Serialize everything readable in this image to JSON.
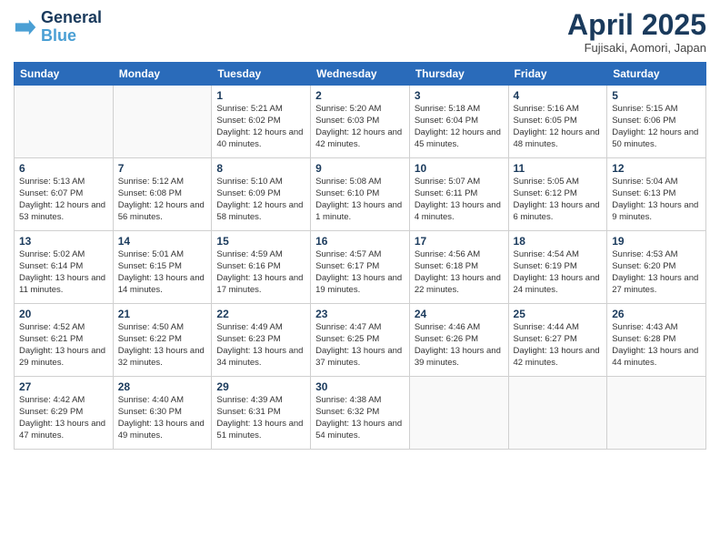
{
  "header": {
    "logo_line1": "General",
    "logo_line2": "Blue",
    "month_title": "April 2025",
    "subtitle": "Fujisaki, Aomori, Japan"
  },
  "weekdays": [
    "Sunday",
    "Monday",
    "Tuesday",
    "Wednesday",
    "Thursday",
    "Friday",
    "Saturday"
  ],
  "weeks": [
    [
      {
        "day": "",
        "info": ""
      },
      {
        "day": "",
        "info": ""
      },
      {
        "day": "1",
        "info": "Sunrise: 5:21 AM\nSunset: 6:02 PM\nDaylight: 12 hours and 40 minutes."
      },
      {
        "day": "2",
        "info": "Sunrise: 5:20 AM\nSunset: 6:03 PM\nDaylight: 12 hours and 42 minutes."
      },
      {
        "day": "3",
        "info": "Sunrise: 5:18 AM\nSunset: 6:04 PM\nDaylight: 12 hours and 45 minutes."
      },
      {
        "day": "4",
        "info": "Sunrise: 5:16 AM\nSunset: 6:05 PM\nDaylight: 12 hours and 48 minutes."
      },
      {
        "day": "5",
        "info": "Sunrise: 5:15 AM\nSunset: 6:06 PM\nDaylight: 12 hours and 50 minutes."
      }
    ],
    [
      {
        "day": "6",
        "info": "Sunrise: 5:13 AM\nSunset: 6:07 PM\nDaylight: 12 hours and 53 minutes."
      },
      {
        "day": "7",
        "info": "Sunrise: 5:12 AM\nSunset: 6:08 PM\nDaylight: 12 hours and 56 minutes."
      },
      {
        "day": "8",
        "info": "Sunrise: 5:10 AM\nSunset: 6:09 PM\nDaylight: 12 hours and 58 minutes."
      },
      {
        "day": "9",
        "info": "Sunrise: 5:08 AM\nSunset: 6:10 PM\nDaylight: 13 hours and 1 minute."
      },
      {
        "day": "10",
        "info": "Sunrise: 5:07 AM\nSunset: 6:11 PM\nDaylight: 13 hours and 4 minutes."
      },
      {
        "day": "11",
        "info": "Sunrise: 5:05 AM\nSunset: 6:12 PM\nDaylight: 13 hours and 6 minutes."
      },
      {
        "day": "12",
        "info": "Sunrise: 5:04 AM\nSunset: 6:13 PM\nDaylight: 13 hours and 9 minutes."
      }
    ],
    [
      {
        "day": "13",
        "info": "Sunrise: 5:02 AM\nSunset: 6:14 PM\nDaylight: 13 hours and 11 minutes."
      },
      {
        "day": "14",
        "info": "Sunrise: 5:01 AM\nSunset: 6:15 PM\nDaylight: 13 hours and 14 minutes."
      },
      {
        "day": "15",
        "info": "Sunrise: 4:59 AM\nSunset: 6:16 PM\nDaylight: 13 hours and 17 minutes."
      },
      {
        "day": "16",
        "info": "Sunrise: 4:57 AM\nSunset: 6:17 PM\nDaylight: 13 hours and 19 minutes."
      },
      {
        "day": "17",
        "info": "Sunrise: 4:56 AM\nSunset: 6:18 PM\nDaylight: 13 hours and 22 minutes."
      },
      {
        "day": "18",
        "info": "Sunrise: 4:54 AM\nSunset: 6:19 PM\nDaylight: 13 hours and 24 minutes."
      },
      {
        "day": "19",
        "info": "Sunrise: 4:53 AM\nSunset: 6:20 PM\nDaylight: 13 hours and 27 minutes."
      }
    ],
    [
      {
        "day": "20",
        "info": "Sunrise: 4:52 AM\nSunset: 6:21 PM\nDaylight: 13 hours and 29 minutes."
      },
      {
        "day": "21",
        "info": "Sunrise: 4:50 AM\nSunset: 6:22 PM\nDaylight: 13 hours and 32 minutes."
      },
      {
        "day": "22",
        "info": "Sunrise: 4:49 AM\nSunset: 6:23 PM\nDaylight: 13 hours and 34 minutes."
      },
      {
        "day": "23",
        "info": "Sunrise: 4:47 AM\nSunset: 6:25 PM\nDaylight: 13 hours and 37 minutes."
      },
      {
        "day": "24",
        "info": "Sunrise: 4:46 AM\nSunset: 6:26 PM\nDaylight: 13 hours and 39 minutes."
      },
      {
        "day": "25",
        "info": "Sunrise: 4:44 AM\nSunset: 6:27 PM\nDaylight: 13 hours and 42 minutes."
      },
      {
        "day": "26",
        "info": "Sunrise: 4:43 AM\nSunset: 6:28 PM\nDaylight: 13 hours and 44 minutes."
      }
    ],
    [
      {
        "day": "27",
        "info": "Sunrise: 4:42 AM\nSunset: 6:29 PM\nDaylight: 13 hours and 47 minutes."
      },
      {
        "day": "28",
        "info": "Sunrise: 4:40 AM\nSunset: 6:30 PM\nDaylight: 13 hours and 49 minutes."
      },
      {
        "day": "29",
        "info": "Sunrise: 4:39 AM\nSunset: 6:31 PM\nDaylight: 13 hours and 51 minutes."
      },
      {
        "day": "30",
        "info": "Sunrise: 4:38 AM\nSunset: 6:32 PM\nDaylight: 13 hours and 54 minutes."
      },
      {
        "day": "",
        "info": ""
      },
      {
        "day": "",
        "info": ""
      },
      {
        "day": "",
        "info": ""
      }
    ]
  ]
}
